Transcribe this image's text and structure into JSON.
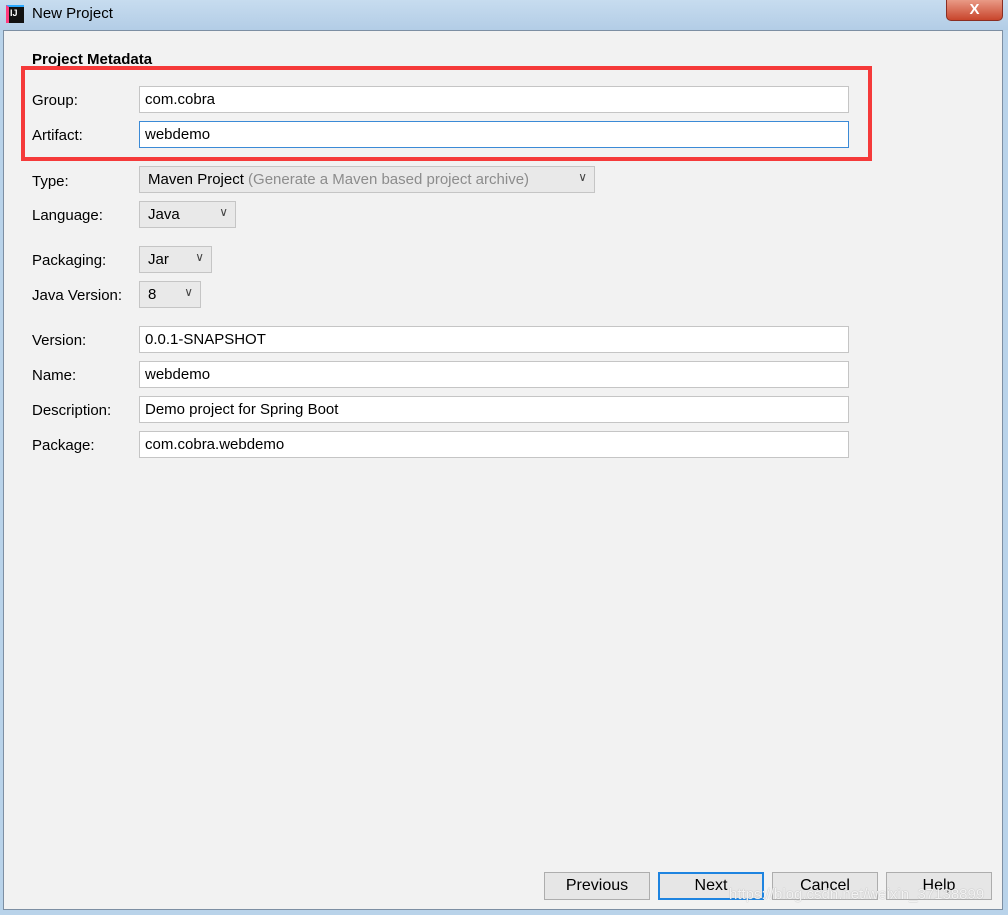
{
  "window": {
    "title": "New Project",
    "close_label": "X"
  },
  "section_title": "Project Metadata",
  "fields": {
    "group": {
      "label": "Group:",
      "value": "com.cobra"
    },
    "artifact": {
      "label": "Artifact:",
      "value": "webdemo"
    },
    "type": {
      "label": "Type:",
      "value": "Maven Project",
      "hint": "(Generate a Maven based project archive)"
    },
    "language": {
      "label": "Language:",
      "value": "Java"
    },
    "packaging": {
      "label": "Packaging:",
      "value": "Jar"
    },
    "java_version": {
      "label": "Java Version:",
      "value": "8"
    },
    "version": {
      "label": "Version:",
      "value": "0.0.1-SNAPSHOT"
    },
    "name": {
      "label": "Name:",
      "value": "webdemo"
    },
    "description": {
      "label": "Description:",
      "value": "Demo project for Spring Boot"
    },
    "package": {
      "label": "Package:",
      "value": "com.cobra.webdemo"
    }
  },
  "buttons": {
    "previous": "Previous",
    "next": "Next",
    "cancel": "Cancel",
    "help": "Help"
  },
  "watermark": "https://blog.csdn.net/weixin_37138899",
  "colors": {
    "highlight": "#f53a3a",
    "focus": "#1e84e0"
  }
}
